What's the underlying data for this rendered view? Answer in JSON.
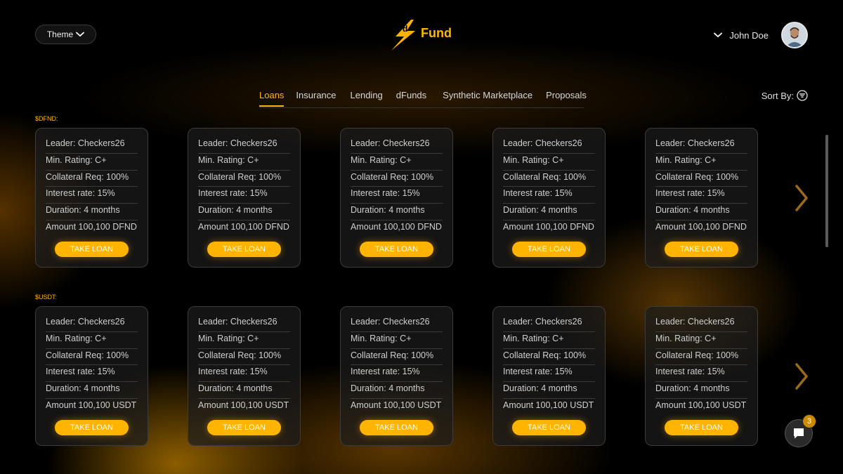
{
  "header": {
    "theme_label": "Theme",
    "logo_text": "Fund",
    "logo_prefix": "d",
    "user_name": "John Doe"
  },
  "tabs": [
    {
      "label": "Loans",
      "active": true
    },
    {
      "label": "Insurance",
      "active": false
    },
    {
      "label": "Lending",
      "active": false
    },
    {
      "label": "dFunds",
      "active": false
    },
    {
      "label": "Synthetic Marketplace",
      "active": false
    },
    {
      "label": "Proposals",
      "active": false
    }
  ],
  "sort_label": "Sort By:",
  "sections": [
    {
      "label": "$DFND:",
      "cards": [
        {
          "leader": "Leader: Checkers26",
          "rating": "Min. Rating: C+",
          "collateral": "Collateral Req: 100%",
          "interest": "Interest rate: 15%",
          "duration": "Duration: 4 months",
          "amount": "Amount 100,100 DFND",
          "button": "TAKE LOAN"
        },
        {
          "leader": "Leader: Checkers26",
          "rating": "Min. Rating: C+",
          "collateral": "Collateral Req: 100%",
          "interest": "Interest rate: 15%",
          "duration": "Duration: 4 months",
          "amount": "Amount 100,100 DFND",
          "button": "TAKE LOAN"
        },
        {
          "leader": "Leader: Checkers26",
          "rating": "Min. Rating: C+",
          "collateral": "Collateral Req: 100%",
          "interest": "Interest rate: 15%",
          "duration": "Duration: 4 months",
          "amount": "Amount 100,100 DFND",
          "button": "TAKE LOAN"
        },
        {
          "leader": "Leader: Checkers26",
          "rating": "Min. Rating: C+",
          "collateral": "Collateral Req: 100%",
          "interest": "Interest rate: 15%",
          "duration": "Duration: 4 months",
          "amount": "Amount 100,100 DFND",
          "button": "TAKE LOAN"
        },
        {
          "leader": "Leader: Checkers26",
          "rating": "Min. Rating: C+",
          "collateral": "Collateral Req: 100%",
          "interest": "Interest rate: 15%",
          "duration": "Duration: 4 months",
          "amount": "Amount 100,100 DFND",
          "button": "TAKE LOAN"
        }
      ]
    },
    {
      "label": "$USDT:",
      "cards": [
        {
          "leader": "Leader: Checkers26",
          "rating": "Min. Rating: C+",
          "collateral": "Collateral Req: 100%",
          "interest": "Interest rate: 15%",
          "duration": "Duration: 4 months",
          "amount": "Amount 100,100 USDT",
          "button": "TAKE LOAN"
        },
        {
          "leader": "Leader: Checkers26",
          "rating": "Min. Rating: C+",
          "collateral": "Collateral Req: 100%",
          "interest": "Interest rate: 15%",
          "duration": "Duration: 4 months",
          "amount": "Amount 100,100 USDT",
          "button": "TAKE LOAN"
        },
        {
          "leader": "Leader: Checkers26",
          "rating": "Min. Rating: C+",
          "collateral": "Collateral Req: 100%",
          "interest": "Interest rate: 15%",
          "duration": "Duration: 4 months",
          "amount": "Amount 100,100 USDT",
          "button": "TAKE LOAN"
        },
        {
          "leader": "Leader: Checkers26",
          "rating": "Min. Rating: C+",
          "collateral": "Collateral Req: 100%",
          "interest": "Interest rate: 15%",
          "duration": "Duration: 4 months",
          "amount": "Amount 100,100 USDT",
          "button": "TAKE LOAN"
        },
        {
          "leader": "Leader: Checkers26",
          "rating": "Min. Rating: C+",
          "collateral": "Collateral Req: 100%",
          "interest": "Interest rate: 15%",
          "duration": "Duration: 4 months",
          "amount": "Amount 100,100 USDT",
          "button": "TAKE LOAN"
        }
      ]
    }
  ],
  "chat_badge": "3",
  "colors": {
    "accent": "#ffb800",
    "background": "#000000",
    "card_border": "#3c3c3c"
  },
  "icons": [
    "chevron-down-icon",
    "lightning-logo-icon",
    "filter-icon",
    "chevron-right-icon",
    "chat-icon"
  ]
}
